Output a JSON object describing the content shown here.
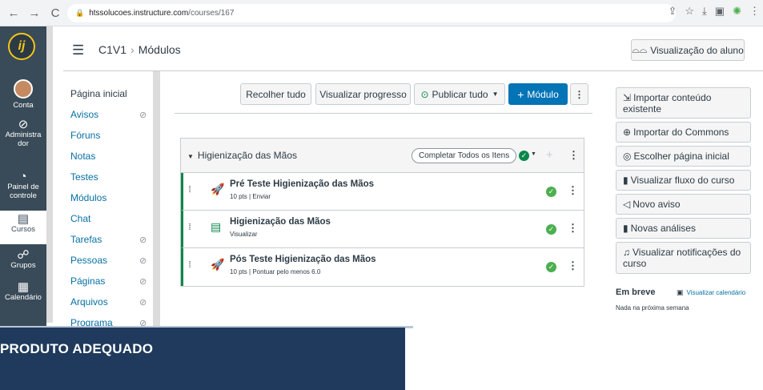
{
  "browser": {
    "url_host": "htssolucoes.instructure.com",
    "url_path": "/courses/167"
  },
  "global_nav": {
    "items": [
      {
        "label": "Conta",
        "icon": "account-avatar"
      },
      {
        "label": "Administra dor",
        "icon": "admin-icon"
      },
      {
        "label": "Painel de controle",
        "icon": "dashboard-icon"
      },
      {
        "label": "Cursos",
        "icon": "courses-icon"
      },
      {
        "label": "Grupos",
        "icon": "groups-icon"
      },
      {
        "label": "Calendário",
        "icon": "calendar-icon"
      }
    ]
  },
  "header": {
    "course": "C1V1",
    "page": "Módulos",
    "student_view": "Visualização do aluno"
  },
  "course_nav": {
    "items": [
      {
        "label": "Página inicial",
        "hidden": false
      },
      {
        "label": "Avisos",
        "hidden": true
      },
      {
        "label": "Fóruns",
        "hidden": false
      },
      {
        "label": "Notas",
        "hidden": false
      },
      {
        "label": "Testes",
        "hidden": false
      },
      {
        "label": "Módulos",
        "hidden": false
      },
      {
        "label": "Chat",
        "hidden": false
      },
      {
        "label": "Tarefas",
        "hidden": true
      },
      {
        "label": "Pessoas",
        "hidden": true
      },
      {
        "label": "Páginas",
        "hidden": true
      },
      {
        "label": "Arquivos",
        "hidden": true
      },
      {
        "label": "Programa",
        "hidden": true
      }
    ]
  },
  "toolbar": {
    "collapse": "Recolher tudo",
    "progress": "Visualizar progresso",
    "publish": "Publicar tudo",
    "add_module": "Módulo"
  },
  "module": {
    "title": "Higienização das Mãos",
    "complete_all": "Completar Todos os Itens",
    "items": [
      {
        "title": "Pré Teste Higienização das Mãos",
        "sub": "10 pts  |  Enviar",
        "icon": "quiz-rocket-icon"
      },
      {
        "title": "Higienização das Mãos",
        "sub": "Visualizar",
        "icon": "page-icon"
      },
      {
        "title": "Pós Teste Higienização das Mãos",
        "sub": "10 pts  |  Pontuar pelo menos 6.0",
        "icon": "quiz-rocket-icon"
      }
    ]
  },
  "sidebar": {
    "import_content": "Importar conteúdo existente",
    "import_commons": "Importar do Commons",
    "choose_home": "Escolher página inicial",
    "course_stream": "Visualizar fluxo do curso",
    "new_announcement": "Novo aviso",
    "new_analytics": "Novas análises",
    "notifications": "Visualizar notificações do curso",
    "coming_up": "Em breve",
    "view_calendar": "Visualizar calendário",
    "nothing": "Nada na próxima semana"
  },
  "banner": {
    "text": "PRODUTO ADEQUADO"
  },
  "colors": {
    "nav_bg": "#394b58",
    "primary": "#0374b5",
    "published": "#0b874b",
    "banner": "#1f3a5c"
  }
}
